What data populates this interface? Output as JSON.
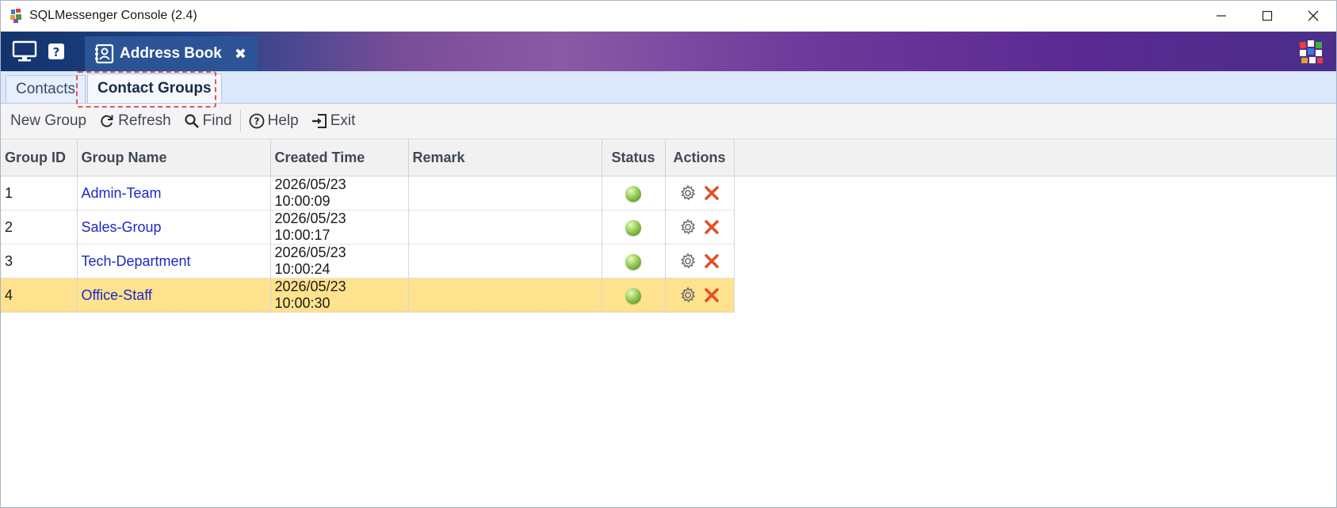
{
  "window": {
    "title": "SQLMessenger Console (2.4)"
  },
  "banner": {
    "doc_tab_label": "Address Book",
    "doc_tab_close": "✖"
  },
  "subtabs": [
    {
      "label": "Contacts",
      "active": false
    },
    {
      "label": "Contact Groups",
      "active": true
    }
  ],
  "toolbar": {
    "new_group": "New Group",
    "refresh": "Refresh",
    "find": "Find",
    "help": "Help",
    "exit": "Exit"
  },
  "table": {
    "columns": [
      "Group ID",
      "Group Name",
      "Created Time",
      "Remark",
      "Status",
      "Actions"
    ],
    "rows": [
      {
        "id": "1",
        "name": "Admin-Team",
        "created": "2026/05/23 10:00:09",
        "remark": "",
        "status": "active",
        "selected": false
      },
      {
        "id": "2",
        "name": "Sales-Group",
        "created": "2026/05/23 10:00:17",
        "remark": "",
        "status": "active",
        "selected": false
      },
      {
        "id": "3",
        "name": "Tech-Department",
        "created": "2026/05/23 10:00:24",
        "remark": "",
        "status": "active",
        "selected": false
      },
      {
        "id": "4",
        "name": "Office-Staff",
        "created": "2026/05/23 10:00:30",
        "remark": "",
        "status": "active",
        "selected": true
      }
    ]
  },
  "colors": {
    "link": "#1c28c8",
    "selected_row": "#ffe28d",
    "highlight_border": "#e05656",
    "status_active": "#7cc043",
    "delete_icon": "#e0502a"
  },
  "icons": {
    "app": "sqlmessenger-app-icon",
    "monitor": "monitor-icon",
    "help": "help-icon",
    "address_book": "address-book-icon",
    "refresh": "refresh-icon",
    "find": "search-icon",
    "help_toolbar": "help-circle-icon",
    "exit": "exit-icon",
    "settings": "gear-icon",
    "delete": "delete-icon"
  }
}
